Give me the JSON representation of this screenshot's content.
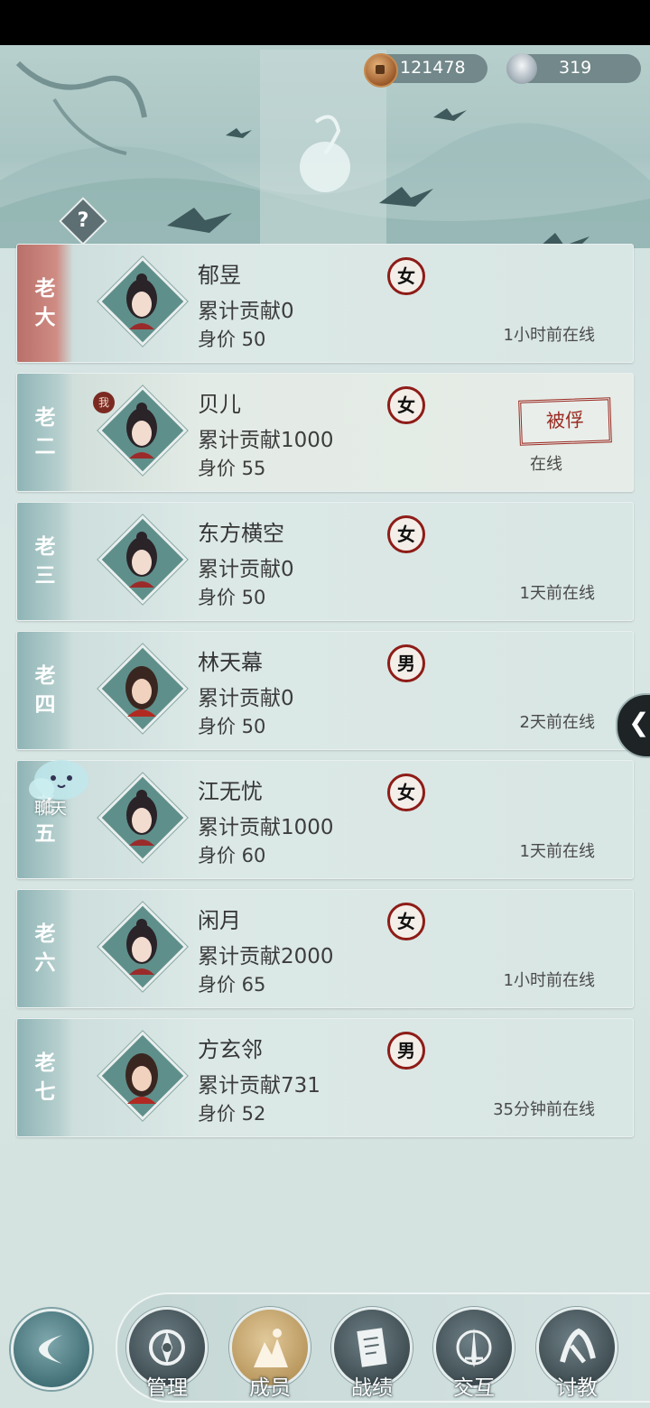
{
  "currencies": {
    "copper": {
      "value": "121478",
      "icon": "copper-coin-icon"
    },
    "silver": {
      "value": "319",
      "icon": "silver-ingot-icon"
    }
  },
  "help": {
    "label": "?"
  },
  "members": [
    {
      "rank_chars": [
        "老",
        "大"
      ],
      "name": "郁昱",
      "contribution": "累计贡献0",
      "price": "身价 50",
      "gender": "女",
      "online": "1小时前在线",
      "is_me": false,
      "avatar": "female"
    },
    {
      "rank_chars": [
        "老",
        "二"
      ],
      "name": "贝儿",
      "contribution": "累计贡献1000",
      "price": "身价 55",
      "gender": "女",
      "online": "在线",
      "is_me": true,
      "me_badge": "我",
      "status_stamp": "被俘",
      "avatar": "female"
    },
    {
      "rank_chars": [
        "老",
        "三"
      ],
      "name": "东方横空",
      "contribution": "累计贡献0",
      "price": "身价 50",
      "gender": "女",
      "online": "1天前在线",
      "is_me": false,
      "avatar": "female"
    },
    {
      "rank_chars": [
        "老",
        "四"
      ],
      "name": "林天幕",
      "contribution": "累计贡献0",
      "price": "身价 50",
      "gender": "男",
      "online": "2天前在线",
      "is_me": false,
      "avatar": "male"
    },
    {
      "rank_chars": [
        "老",
        "五"
      ],
      "name": "江无忧",
      "contribution": "累计贡献1000",
      "price": "身价 60",
      "gender": "女",
      "online": "1天前在线",
      "is_me": false,
      "avatar": "female"
    },
    {
      "rank_chars": [
        "老",
        "六"
      ],
      "name": "闲月",
      "contribution": "累计贡献2000",
      "price": "身价 65",
      "gender": "女",
      "online": "1小时前在线",
      "is_me": false,
      "avatar": "female"
    },
    {
      "rank_chars": [
        "老",
        "七"
      ],
      "name": "方玄邻",
      "contribution": "累计贡献731",
      "price": "身价 52",
      "gender": "男",
      "online": "35分钟前在线",
      "is_me": false,
      "avatar": "male"
    }
  ],
  "chat": {
    "label": "聊天"
  },
  "side_tab": {
    "icon": "chevron-left-icon"
  },
  "nav": {
    "back_icon": "back-arrow-icon",
    "items": [
      {
        "label": "管理",
        "icon": "gear-emblem-icon",
        "active": false
      },
      {
        "label": "成员",
        "icon": "members-icon",
        "active": true
      },
      {
        "label": "战绩",
        "icon": "scroll-icon",
        "active": false
      },
      {
        "label": "交互",
        "icon": "crossed-swords-icon",
        "active": false
      },
      {
        "label": "讨教",
        "icon": "spar-icon",
        "active": false
      }
    ]
  }
}
